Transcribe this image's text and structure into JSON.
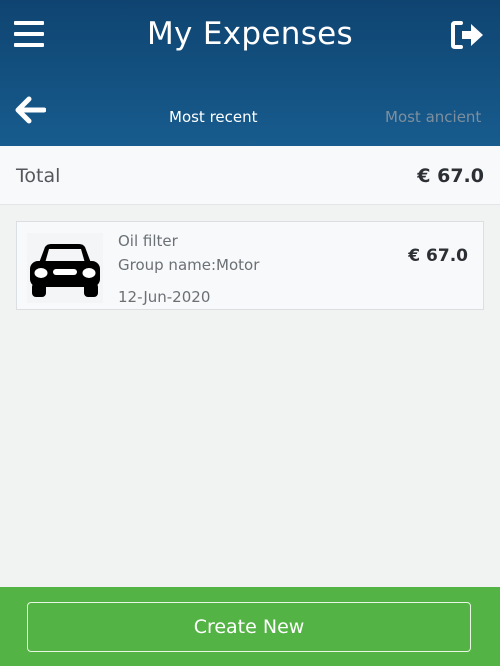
{
  "header": {
    "title": "My Expenses",
    "menu_icon": "hamburger-menu-icon",
    "logout_icon": "sign-out-icon",
    "back_icon": "arrow-left-icon",
    "background_color": "#175c8e"
  },
  "sort_tabs": [
    {
      "label": "Most recent",
      "active": true
    },
    {
      "label": "Most ancient",
      "active": false
    }
  ],
  "summary": {
    "total_label": "Total",
    "total_value": "€ 67.0"
  },
  "expenses": [
    {
      "icon": "car-icon",
      "name": "Oil filter",
      "group": "Group name:Motor",
      "date": "12-Jun-2020",
      "amount": "€ 67.0"
    }
  ],
  "footer": {
    "create_label": "Create New",
    "background_color": "#53b344"
  }
}
